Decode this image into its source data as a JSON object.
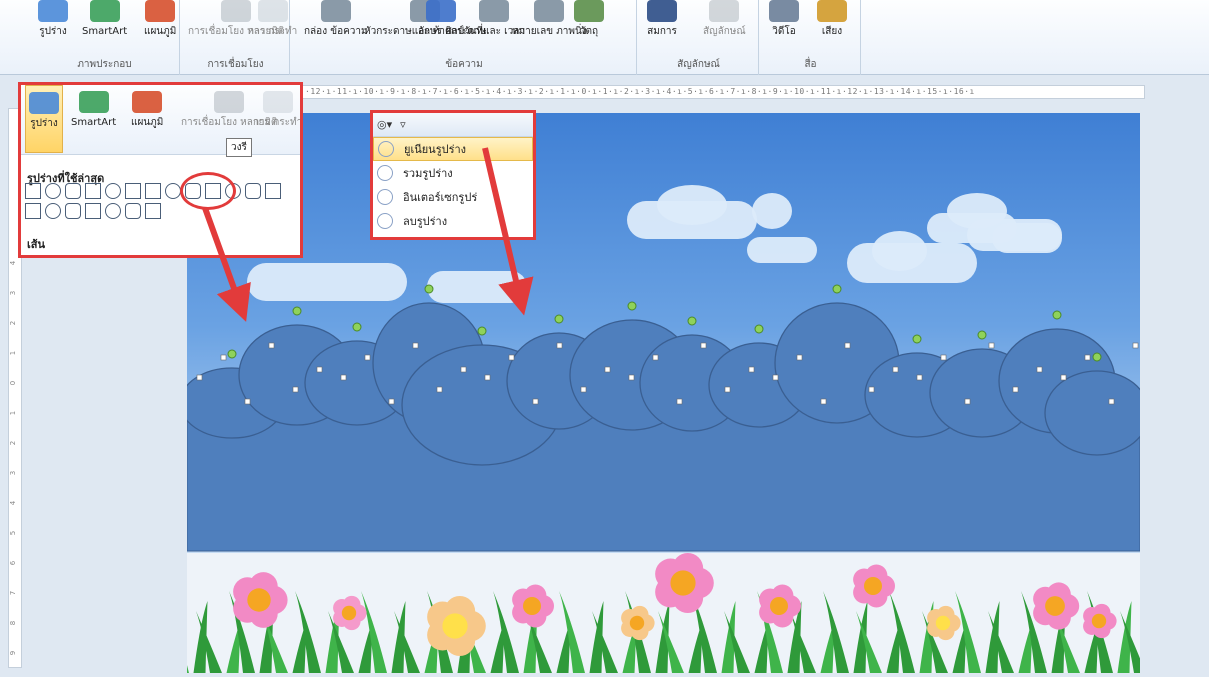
{
  "ribbon": {
    "groups": [
      {
        "label": "ภาพประกอบ",
        "buttons": [
          {
            "label": "รูปร่าง",
            "icon": "shapes-icon",
            "dim": false
          },
          {
            "label": "SmartArt",
            "icon": "smartart-icon",
            "dim": false
          },
          {
            "label": "แผนภูมิ",
            "icon": "chart-icon",
            "dim": false
          }
        ]
      },
      {
        "label": "การเชื่อมโยง",
        "buttons": [
          {
            "label": "การเชื่อมโยง หลายมิติ",
            "icon": "hyperlink-icon",
            "dim": true
          },
          {
            "label": "การ กระทำ",
            "icon": "action-icon",
            "dim": true
          }
        ]
      },
      {
        "label": "ข้อความ",
        "buttons": [
          {
            "label": "กล่อง ข้อความ",
            "icon": "textbox-icon",
            "dim": false
          },
          {
            "label": "หัวกระดาษและ ท้ายกระดาษ",
            "icon": "header-footer-icon",
            "dim": false
          },
          {
            "label": "อักษร ศิลป์",
            "icon": "wordart-icon",
            "dim": false
          },
          {
            "label": "วันที่และ เวลา",
            "icon": "datetime-icon",
            "dim": false
          },
          {
            "label": "หมายเลข ภาพนิ่ง",
            "icon": "slide-number-icon",
            "dim": false
          },
          {
            "label": "วัตถุ",
            "icon": "object-icon",
            "dim": false
          }
        ]
      },
      {
        "label": "สัญลักษณ์",
        "buttons": [
          {
            "label": "สมการ",
            "icon": "equation-icon",
            "dim": false
          },
          {
            "label": "สัญลักษณ์",
            "icon": "symbol-icon",
            "dim": true
          }
        ]
      },
      {
        "label": "สื่อ",
        "buttons": [
          {
            "label": "วิดีโอ",
            "icon": "video-icon",
            "dim": false
          },
          {
            "label": "เสียง",
            "icon": "audio-icon",
            "dim": false
          }
        ]
      }
    ]
  },
  "ruler": {
    "h_text": "·12·ı·11·ı·10·ı·9·ı·8·ı·7·ı·6·ı·5·ı·4·ı·3·ı·2·ı·1·ı·0·ı·1·ı·2·ı·3·ı·4·ı·5·ı·6·ı·7·ı·8·ı·9·ı·10·ı·11·ı·12·ı·13·ı·14·ı·15·ı·16·ı",
    "v_ticks": [
      "4",
      "3",
      "2",
      "1",
      "0",
      "1",
      "2",
      "3",
      "4",
      "5",
      "6",
      "7",
      "8",
      "9"
    ]
  },
  "shapes_popup": {
    "buttons": [
      "รูปร่าง",
      "SmartArt",
      "แผนภูมิ",
      "การเชื่อมโยง หลายมิติ",
      "การ กระทำ"
    ],
    "recent_heading": "รูปร่างที่ใช้ล่าสุด",
    "lines_heading": "เส้น",
    "tooltip": "วงรี"
  },
  "merge_popup": {
    "items": [
      "ยูเนียนรูปร่าง",
      "รวมรูปร่าง",
      "อินเตอร์เซกรูปร่",
      "ลบรูปร่าง"
    ],
    "highlighted": 0
  },
  "colors": {
    "annotation_red": "#e23b3b",
    "bush_fill": "#4f7fbd",
    "bush_stroke": "#3a5f92",
    "grass_green": "#2f9a3a"
  }
}
